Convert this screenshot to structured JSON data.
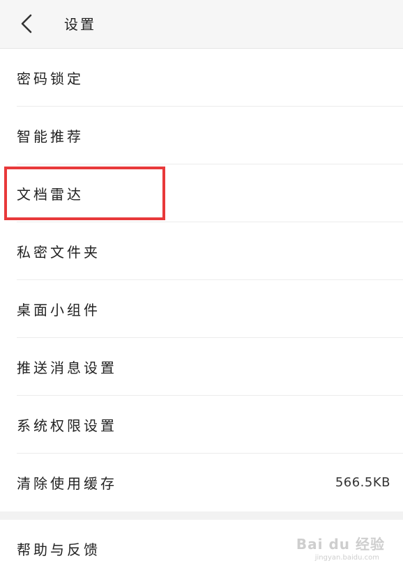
{
  "header": {
    "title": "设置"
  },
  "settings": {
    "items": [
      {
        "label": "密码锁定"
      },
      {
        "label": "智能推荐"
      },
      {
        "label": "文档雷达"
      },
      {
        "label": "私密文件夹"
      },
      {
        "label": "桌面小组件"
      },
      {
        "label": "推送消息设置"
      },
      {
        "label": "系统权限设置"
      },
      {
        "label": "清除使用缓存",
        "value": "566.5KB"
      }
    ],
    "footer_item": {
      "label": "帮助与反馈"
    }
  },
  "watermark": {
    "text": "Bai du 经验",
    "sub": "jingyan.baidu.com"
  },
  "colors": {
    "highlight": "#e8393a",
    "header_bg": "#f6f6f6",
    "divider": "#ececec"
  }
}
